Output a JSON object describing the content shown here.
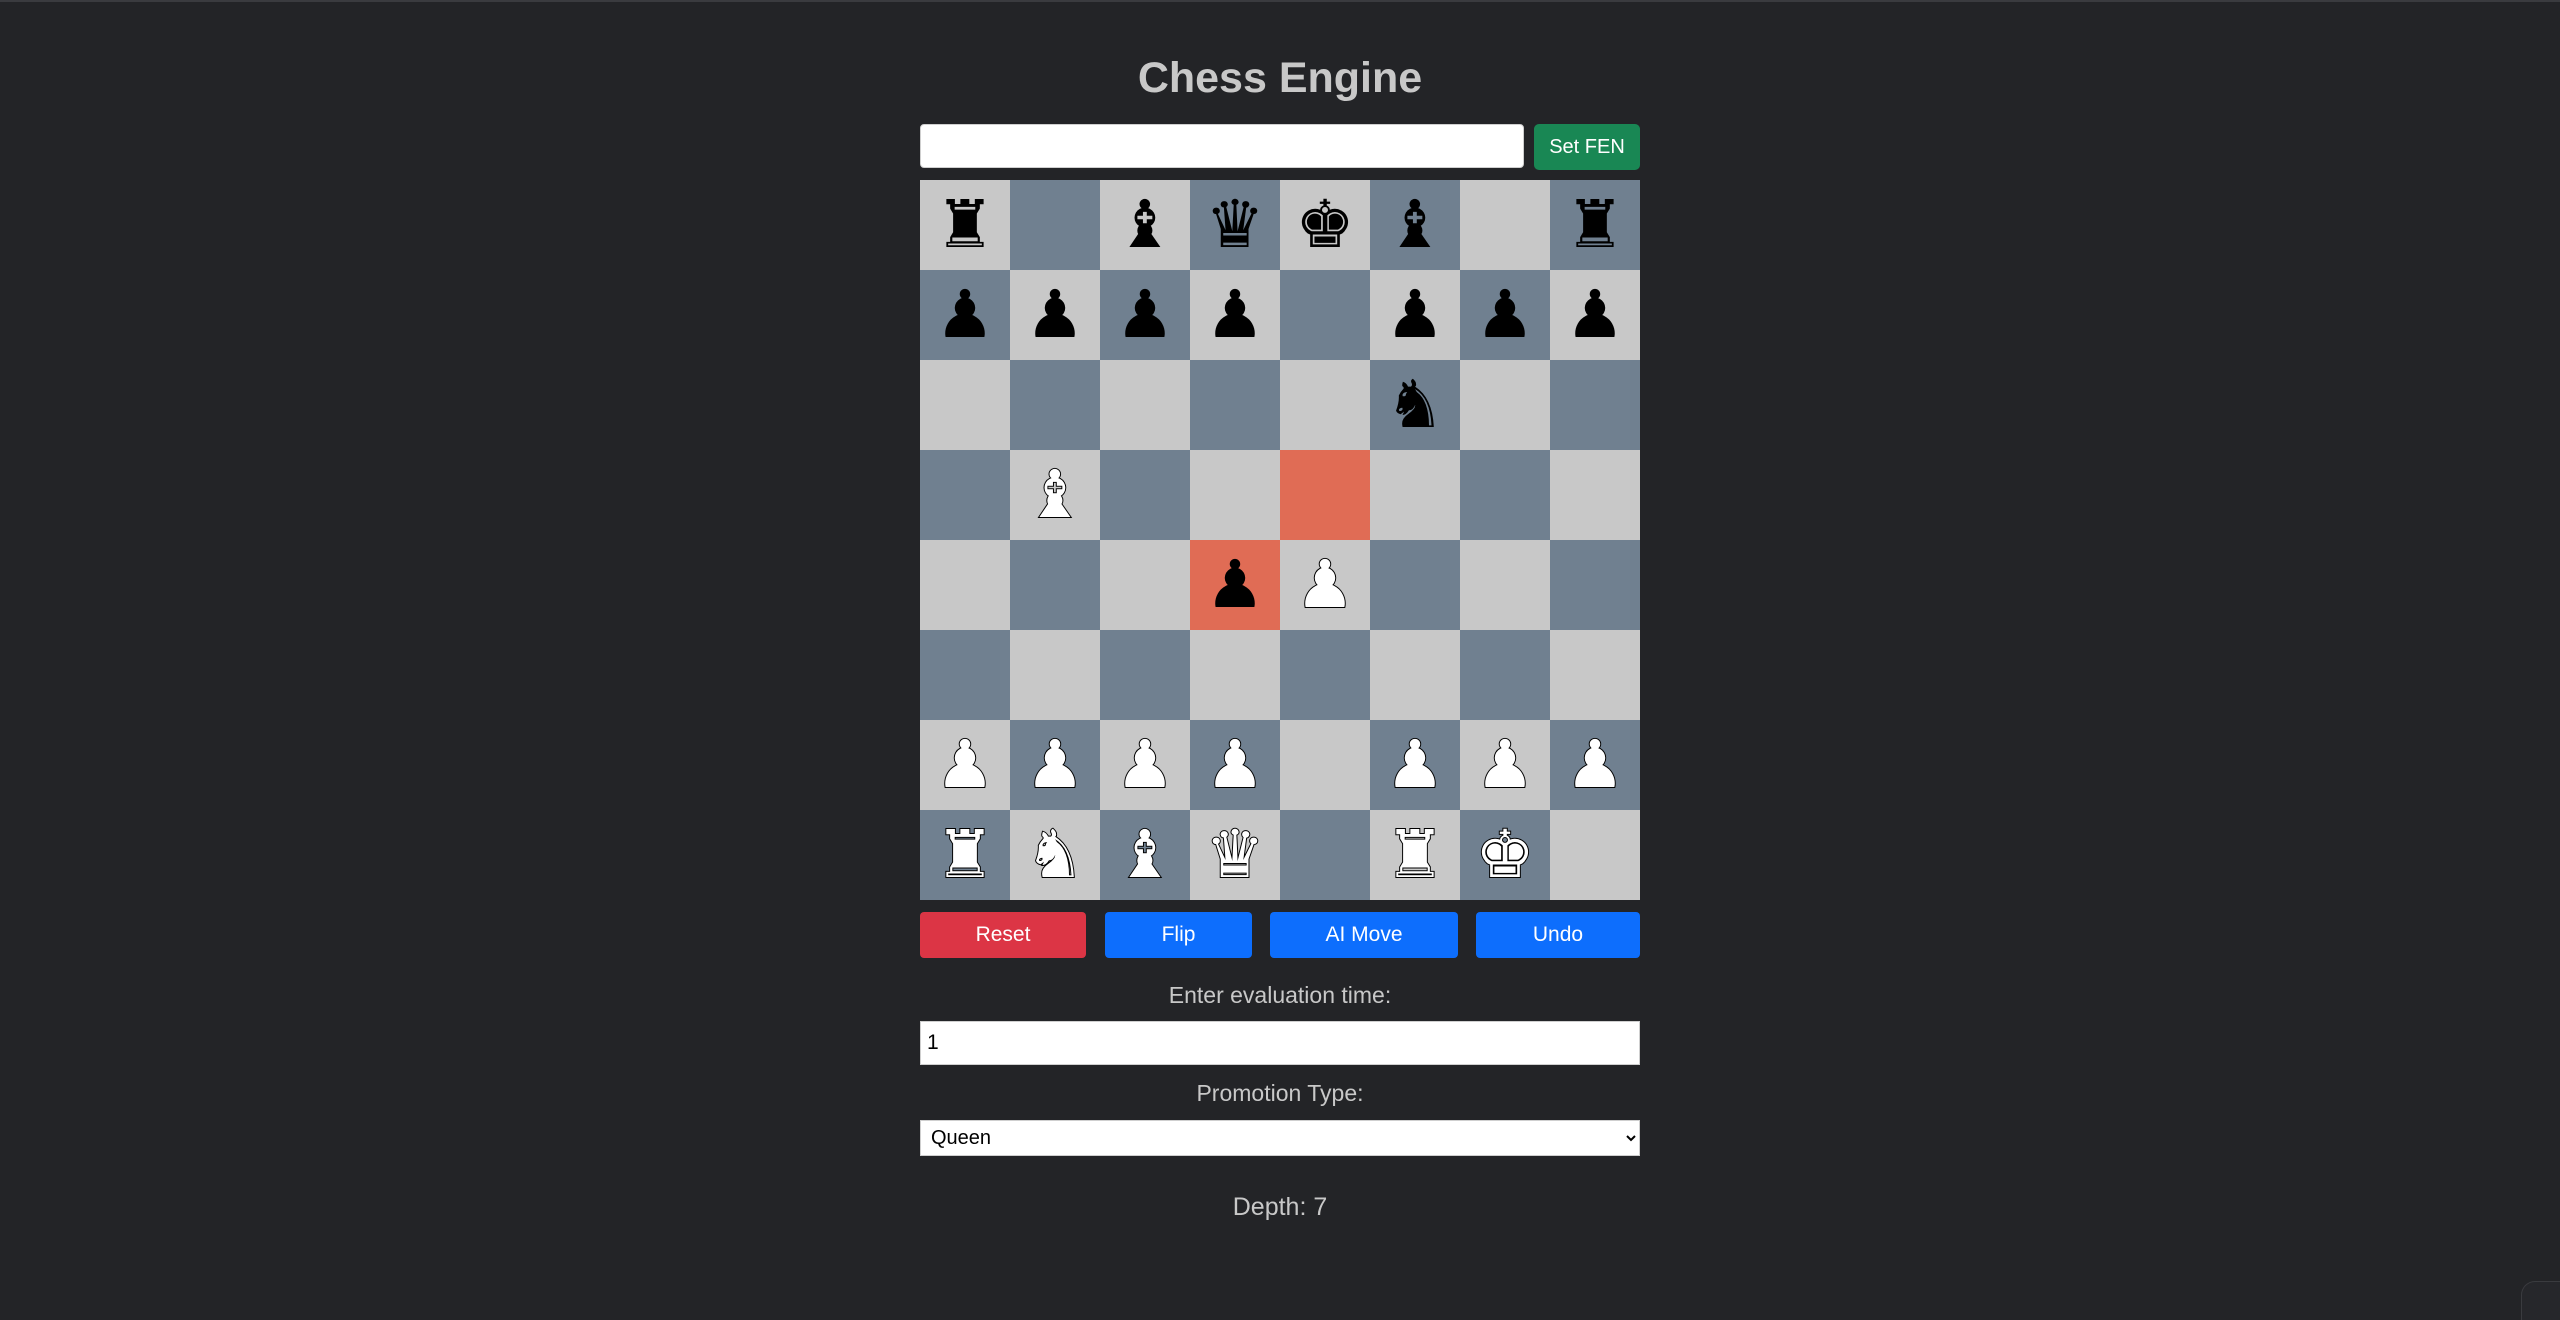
{
  "title": "Chess Engine",
  "fen": {
    "value": "",
    "button_label": "Set FEN"
  },
  "board": {
    "ranks": [
      [
        "bR",
        "",
        "bB",
        "bQ",
        "bK",
        "bB",
        "",
        "bR"
      ],
      [
        "bP",
        "bP",
        "bP",
        "bP",
        "",
        "bP",
        "bP",
        "bP"
      ],
      [
        "",
        "",
        "",
        "",
        "",
        "bN",
        "",
        ""
      ],
      [
        "",
        "wB",
        "",
        "",
        "",
        "",
        "",
        ""
      ],
      [
        "",
        "",
        "",
        "bP",
        "wP",
        "",
        "",
        ""
      ],
      [
        "",
        "",
        "",
        "",
        "",
        "",
        "",
        ""
      ],
      [
        "wP",
        "wP",
        "wP",
        "wP",
        "",
        "wP",
        "wP",
        "wP"
      ],
      [
        "wR",
        "wN",
        "wB",
        "wQ",
        "",
        "wR",
        "wK",
        ""
      ]
    ],
    "highlighted": [
      [
        3,
        4
      ],
      [
        4,
        3
      ]
    ],
    "colors": {
      "light": "#c8c8c8",
      "dark": "#708090",
      "highlight": "#e06c55"
    }
  },
  "controls": {
    "reset_label": "Reset",
    "flip_label": "Flip",
    "ai_move_label": "AI Move",
    "undo_label": "Undo"
  },
  "eval_time": {
    "label": "Enter evaluation time:",
    "value": "1"
  },
  "promotion": {
    "label": "Promotion Type:",
    "selected": "Queen"
  },
  "depth": {
    "text": "Depth: 7"
  }
}
